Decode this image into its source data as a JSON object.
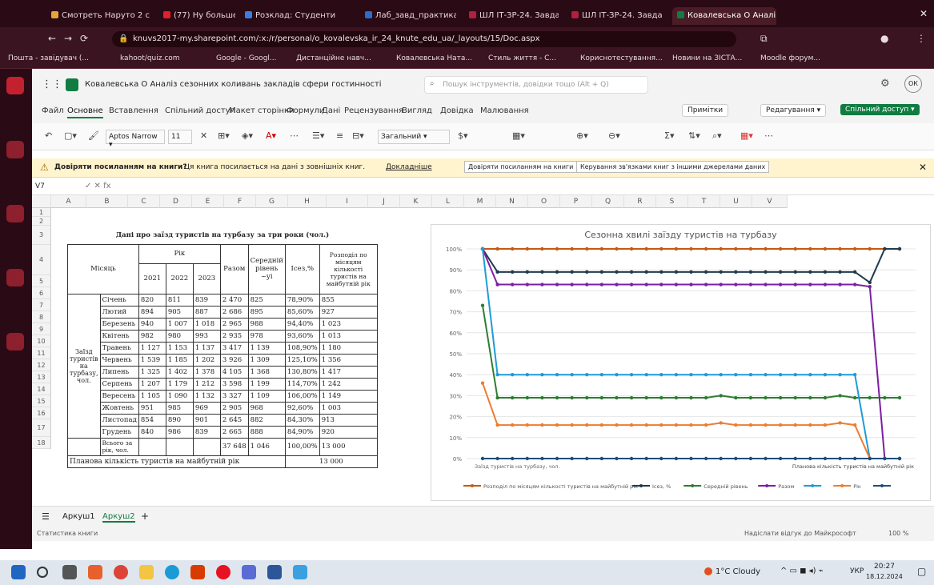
{
  "browser": {
    "tabs": [
      {
        "label": "Смотреть Наруто 2 с",
        "color": "#e8a23a"
      },
      {
        "label": "(77) Ну больше ⚙",
        "color": "#e0202a"
      },
      {
        "label": "Розклад: Студенти",
        "color": "#3a7de0"
      },
      {
        "label": "Лаб_завд_практика",
        "color": "#2b6cd1"
      },
      {
        "label": "ШЛ ІТ-ЗР-24. Завдання",
        "color": "#b02040"
      },
      {
        "label": "ШЛ ІТ-ЗР-24. Завдання",
        "color": "#b02040"
      },
      {
        "label": "Ковалевська О Аналі",
        "color": "#107c41",
        "active": true
      }
    ],
    "url": "knuvs2017-my.sharepoint.com/:x:/r/personal/o_kovalevska_ir_24_knute_edu_ua/_layouts/15/Doc.aspx",
    "bookmarks": [
      "Пошта - завідувач (...",
      "kahoot/quiz.com",
      "Google - Googl...",
      "Дистанційне навч...",
      "Ковалевська Ната...",
      "Стиль життя - С...",
      "Кориснотестування...",
      "Новини на ЗІСТА...",
      "Moodle форум..."
    ]
  },
  "excel": {
    "doc_title": "Ковалевська О Аналіз сезонних коливань закладів сфери гостинності",
    "search_placeholder": "Пошук інструментів, довідки тощо (Alt + Q)",
    "ribbon_tabs": [
      "Файл",
      "Основне",
      "Вставлення",
      "Спільний доступ",
      "Макет сторінки",
      "Формули",
      "Дані",
      "Рецензування",
      "Вигляд",
      "Довідка",
      "Малювання"
    ],
    "active_ribbon": "Основне",
    "right_buttons": {
      "comments": "Примітки",
      "editing": "Редагування",
      "share": "Спільний доступ"
    },
    "font_name": "Aptos Narrow",
    "font_size": "11",
    "number_format": "Загальний",
    "warning_bold": "Довіряти посиланням на книги?",
    "warning_text": "Ця книга посилається на дані з зовнішніх книг.",
    "warning_link": "Докладніше",
    "warning_btn1": "Довіряти посиланням на книги",
    "warning_btn2": "Керування зв'язками книг з іншими джерелами даних",
    "cell_ref": "V7",
    "formula": "",
    "columns": [
      "A",
      "B",
      "C",
      "D",
      "E",
      "F",
      "G",
      "H",
      "I",
      "J",
      "K",
      "L",
      "M",
      "N",
      "O",
      "P",
      "Q",
      "R",
      "S",
      "T",
      "U",
      "V"
    ],
    "rows": [
      "1",
      "2",
      "3",
      "4",
      "5",
      "6",
      "7",
      "8",
      "9",
      "10",
      "11",
      "12",
      "13",
      "14",
      "15",
      "16",
      "17",
      "18"
    ],
    "sheet_tabs": [
      "Аркуш1",
      "Аркуш2"
    ],
    "active_sheet": "Аркуш2",
    "status_left": "Статистика книги",
    "status_right": "Надіслати відгук до Майкрософт",
    "zoom": "100 %"
  },
  "table": {
    "title": "Дані про заїзд туристів на турбазу за три роки (чол.)",
    "h_month": "Місяць",
    "h_year": "Рік",
    "years": [
      "2021",
      "2022",
      "2023"
    ],
    "h_total": "Разом",
    "h_avg": "Середній рівень",
    "h_avg_sym": "~yi",
    "h_index": "Ісез,%",
    "h_dist": "Розподіл по місяцям кількості туристів на майбутній рік",
    "side_label": "Заїзд туристів на турбазу, чол.",
    "rows": [
      {
        "m": "Січень",
        "a": "820",
        "b": "811",
        "c": "839",
        "t": "2 470",
        "avg": "825",
        "idx": "78,90%",
        "d": "855"
      },
      {
        "m": "Лютий",
        "a": "894",
        "b": "905",
        "c": "887",
        "t": "2 686",
        "avg": "895",
        "idx": "85,60%",
        "d": "927"
      },
      {
        "m": "Березень",
        "a": "940",
        "b": "1 007",
        "c": "1 018",
        "t": "2 965",
        "avg": "988",
        "idx": "94,40%",
        "d": "1 023"
      },
      {
        "m": "Квітень",
        "a": "982",
        "b": "980",
        "c": "993",
        "t": "2 935",
        "avg": "978",
        "idx": "93,60%",
        "d": "1 013"
      },
      {
        "m": "Травень",
        "a": "1 127",
        "b": "1 153",
        "c": "1 137",
        "t": "3 417",
        "avg": "1 139",
        "idx": "108,90%",
        "d": "1 180"
      },
      {
        "m": "Червень",
        "a": "1 539",
        "b": "1 185",
        "c": "1 202",
        "t": "3 926",
        "avg": "1 309",
        "idx": "125,10%",
        "d": "1 356"
      },
      {
        "m": "Липень",
        "a": "1 325",
        "b": "1 402",
        "c": "1 378",
        "t": "4 105",
        "avg": "1 368",
        "idx": "130,80%",
        "d": "1 417"
      },
      {
        "m": "Серпень",
        "a": "1 207",
        "b": "1 179",
        "c": "1 212",
        "t": "3 598",
        "avg": "1 199",
        "idx": "114,70%",
        "d": "1 242"
      },
      {
        "m": "Вересень",
        "a": "1 105",
        "b": "1 090",
        "c": "1 132",
        "t": "3 327",
        "avg": "1 109",
        "idx": "106,00%",
        "d": "1 149"
      },
      {
        "m": "Жовтень",
        "a": "951",
        "b": "985",
        "c": "969",
        "t": "2 905",
        "avg": "968",
        "idx": "92,60%",
        "d": "1 003"
      },
      {
        "m": "Листопад",
        "a": "854",
        "b": "890",
        "c": "901",
        "t": "2 645",
        "avg": "882",
        "idx": "84,30%",
        "d": "913"
      },
      {
        "m": "Грудень",
        "a": "840",
        "b": "986",
        "c": "839",
        "t": "2 665",
        "avg": "888",
        "idx": "84,90%",
        "d": "920"
      }
    ],
    "total_label": "Всього за рік, чол.",
    "total_sum": "37 648",
    "total_avg": "1 046",
    "total_idx": "100,00%",
    "total_dist": "13 000",
    "plan_label": "Планова кількість туристів на майбутній рік",
    "plan_value": "13 000"
  },
  "chart_data": {
    "type": "line",
    "title": "Сезонна хвилі заїзду туристів на турбазу",
    "ylim": [
      0,
      100
    ],
    "yticks": [
      "0%",
      "10%",
      "20%",
      "30%",
      "40%",
      "50%",
      "60%",
      "70%",
      "80%",
      "90%",
      "100%"
    ],
    "x_first_label": "Заїзд туристів на турбазу, чол.",
    "x_last_label": "Планова кількість туристів на майбутній рік",
    "series": [
      {
        "name": "Розподіл по місяцям кількості туристів на майбутній рік",
        "color": "#c55a11",
        "values": [
          100,
          100,
          100,
          100,
          100,
          100,
          100,
          100,
          100,
          100,
          100,
          100,
          100,
          100,
          100,
          100,
          100,
          100,
          100,
          100,
          100,
          100,
          100,
          100,
          100,
          100,
          100,
          100,
          100
        ]
      },
      {
        "name": "Ісез, %",
        "color": "#1f3b4d",
        "values": [
          100,
          89,
          89,
          89,
          89,
          89,
          89,
          89,
          89,
          89,
          89,
          89,
          89,
          89,
          89,
          89,
          89,
          89,
          89,
          89,
          89,
          89,
          89,
          89,
          89,
          89,
          84,
          100,
          100
        ]
      },
      {
        "name": "Середній рівень",
        "color": "#2e7d32",
        "values": [
          73,
          29,
          29,
          29,
          29,
          29,
          29,
          29,
          29,
          29,
          29,
          29,
          29,
          29,
          29,
          29,
          30,
          29,
          29,
          29,
          29,
          29,
          29,
          29,
          30,
          29,
          29,
          29,
          29
        ]
      },
      {
        "name": "Разом",
        "color": "#7b1fa2",
        "values": [
          100,
          83,
          83,
          83,
          83,
          83,
          83,
          83,
          83,
          83,
          83,
          83,
          83,
          83,
          83,
          83,
          83,
          83,
          83,
          83,
          83,
          83,
          83,
          83,
          83,
          83,
          82,
          0,
          0
        ]
      },
      {
        "name": "",
        "color": "#1e9bd7",
        "values": [
          100,
          40,
          40,
          40,
          40,
          40,
          40,
          40,
          40,
          40,
          40,
          40,
          40,
          40,
          40,
          40,
          40,
          40,
          40,
          40,
          40,
          40,
          40,
          40,
          40,
          40,
          0,
          0,
          0
        ]
      },
      {
        "name": "Рік",
        "color": "#ed7d31",
        "values": [
          36,
          16,
          16,
          16,
          16,
          16,
          16,
          16,
          16,
          16,
          16,
          16,
          16,
          16,
          16,
          16,
          17,
          16,
          16,
          16,
          16,
          16,
          16,
          16,
          17,
          16,
          0,
          0,
          0
        ]
      },
      {
        "name": "",
        "color": "#1f4e79",
        "values": [
          0,
          0,
          0,
          0,
          0,
          0,
          0,
          0,
          0,
          0,
          0,
          0,
          0,
          0,
          0,
          0,
          0,
          0,
          0,
          0,
          0,
          0,
          0,
          0,
          0,
          0,
          0,
          0,
          0
        ]
      }
    ]
  },
  "taskbar": {
    "weather": "1°C Cloudy",
    "lang": "УКР",
    "time": "20:27",
    "date": "18.12.2024"
  }
}
